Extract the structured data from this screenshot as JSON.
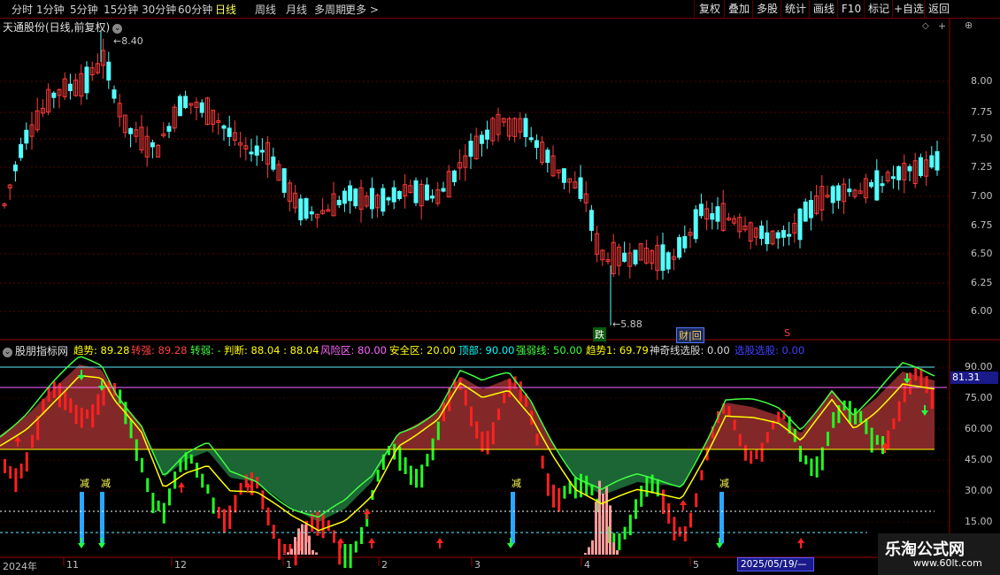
{
  "toolbar": {
    "periods": [
      "分时",
      "1分钟",
      "5分钟",
      "15分钟",
      "30分钟",
      "60分钟",
      "日线",
      "周线",
      "月线",
      "多周期",
      "更多 >"
    ],
    "active": "日线",
    "buttons": [
      "复权",
      "叠加",
      "多股",
      "统计",
      "画线",
      "F10",
      "标记",
      "+自选",
      "返回"
    ]
  },
  "main_chart": {
    "title": "天通股份(日线,前复权)",
    "high_label": "8.40",
    "low_label": "5.88",
    "price_ticks": [
      "8.00",
      "7.75",
      "7.50",
      "7.25",
      "7.00",
      "6.75",
      "6.50",
      "6.25",
      "6.00"
    ],
    "badges": {
      "die": "跌",
      "caibao": "财|回",
      "s": "S"
    },
    "colors": {
      "up": "#ff3b3b",
      "down": "#54ffff",
      "grid": "#7a0000"
    }
  },
  "indicator": {
    "name": "股朋指标网",
    "legend": [
      {
        "text": "趋势: 89.28",
        "color": "#ffff00"
      },
      {
        "text": "转强: 89.28",
        "color": "#ff4040"
      },
      {
        "text": "转弱: -",
        "color": "#40ff40"
      },
      {
        "text": "判断: 88.04 : 88.04",
        "color": "#ffff00"
      },
      {
        "text": "风险区: 80.00",
        "color": "#ff66ff"
      },
      {
        "text": "安全区: 20.00",
        "color": "#ffff00"
      },
      {
        "text": "顶部: 90.00",
        "color": "#00ffff"
      },
      {
        "text": "强弱线: 50.00",
        "color": "#40ff40"
      },
      {
        "text": "趋势1: 69.79",
        "color": "#ffff00"
      },
      {
        "text": "神奇线选股: 0.00",
        "color": "#dddddd"
      },
      {
        "text": "选股选股: 0.00",
        "color": "#4040ff"
      }
    ],
    "ticks": [
      "90.00",
      "75.00",
      "60.00",
      "45.00",
      "30.00",
      "15.00"
    ],
    "current_value": "81.31",
    "signal_label": "减"
  },
  "xaxis": {
    "labels": [
      "2024年",
      "11",
      "12",
      "1",
      "2",
      "3",
      "4",
      "5"
    ],
    "cursor_date": "2025/05/19/—"
  },
  "watermark": {
    "title": "乐淘公式网",
    "url": "www.60lt.com"
  }
}
